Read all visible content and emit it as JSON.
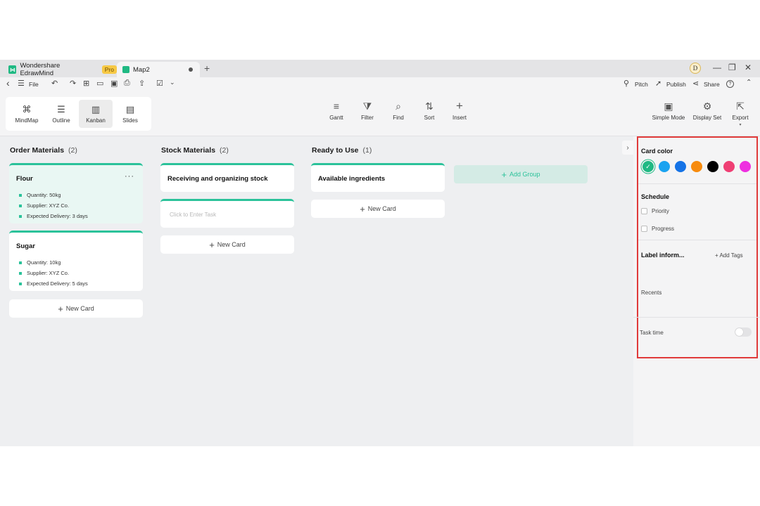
{
  "titlebar": {
    "app_name": "Wondershare EdrawMind",
    "pro_badge": "Pro",
    "doc_tab": "Map2",
    "new_tab": "+",
    "avatar_initial": "D",
    "minimize": "—",
    "restore": "❐",
    "close": "✕"
  },
  "quickbar": {
    "back": "‹",
    "menu": "☰",
    "file_label": "File",
    "undo": "↶",
    "redo": "↷",
    "new": "⊞",
    "open": "▭",
    "save": "▣",
    "print": "⎙",
    "export": "⇪",
    "check": "☑",
    "more": "⌄",
    "pitch": "Pitch",
    "publish": "Publish",
    "share": "Share",
    "help": "?",
    "collapse": "⌃"
  },
  "ribbon": {
    "views": [
      {
        "label": "MindMap",
        "icon": "⌘",
        "active": false
      },
      {
        "label": "Outline",
        "icon": "☰",
        "active": false
      },
      {
        "label": "Kanban",
        "icon": "▥",
        "active": true
      },
      {
        "label": "Slides",
        "icon": "▤",
        "active": false
      }
    ],
    "tools": [
      {
        "label": "Gantt",
        "icon": "≡"
      },
      {
        "label": "Filter",
        "icon": "⧩"
      },
      {
        "label": "Find",
        "icon": "⌕"
      },
      {
        "label": "Sort",
        "icon": "⇅"
      },
      {
        "label": "Insert",
        "icon": "+"
      }
    ],
    "right_tools": [
      {
        "label": "Simple Mode",
        "icon": "▣"
      },
      {
        "label": "Display Set",
        "icon": "⚙"
      },
      {
        "label": "Export",
        "icon": "⇱"
      }
    ],
    "export_caret": "▾"
  },
  "board": {
    "columns": [
      {
        "title": "Order Materials",
        "count": "(2)",
        "cards": [
          {
            "title": "Flour",
            "more": "···",
            "items": [
              "Quantity: 50kg",
              "Supplier: XYZ Co.",
              "Expected Delivery: 3 days"
            ]
          },
          {
            "title": "Sugar",
            "items": [
              "Quantity: 10kg",
              "Supplier: XYZ Co.",
              "Expected Delivery: 5 days"
            ]
          }
        ],
        "new_card": "New Card"
      },
      {
        "title": "Stock Materials",
        "count": "(2)",
        "cards": [
          {
            "title": "Receiving and organizing stock"
          },
          {
            "placeholder": "Click to Enter Task"
          }
        ],
        "new_card": "New Card"
      },
      {
        "title": "Ready to Use",
        "count": "(1)",
        "cards": [
          {
            "title": "Available ingredients"
          }
        ],
        "new_card": "New Card"
      }
    ],
    "add_group": "Add Group",
    "plus": "+",
    "collapse_panel": "›"
  },
  "panel": {
    "card_color_title": "Card color",
    "colors": [
      "#1fb983",
      "#1aa3f0",
      "#1573e6",
      "#f78b0e",
      "#000000",
      "#ef3f74",
      "#ee2fe0"
    ],
    "selected_check": "✓",
    "schedule_title": "Schedule",
    "priority": "Priority",
    "progress": "Progress",
    "label_title": "Label inform...",
    "add_tags": "+ Add Tags",
    "recents": "Recents",
    "task_time": "Task time",
    "task_time_on": false
  }
}
